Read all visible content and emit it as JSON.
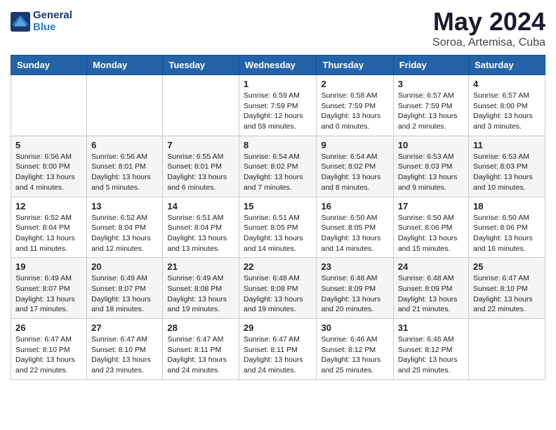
{
  "header": {
    "logo_line1": "General",
    "logo_line2": "Blue",
    "title": "May 2024",
    "subtitle": "Soroa, Artemisa, Cuba"
  },
  "weekdays": [
    "Sunday",
    "Monday",
    "Tuesday",
    "Wednesday",
    "Thursday",
    "Friday",
    "Saturday"
  ],
  "weeks": [
    [
      {
        "day": "",
        "info": ""
      },
      {
        "day": "",
        "info": ""
      },
      {
        "day": "",
        "info": ""
      },
      {
        "day": "1",
        "info": "Sunrise: 6:59 AM\nSunset: 7:59 PM\nDaylight: 12 hours\nand 59 minutes."
      },
      {
        "day": "2",
        "info": "Sunrise: 6:58 AM\nSunset: 7:59 PM\nDaylight: 13 hours\nand 0 minutes."
      },
      {
        "day": "3",
        "info": "Sunrise: 6:57 AM\nSunset: 7:59 PM\nDaylight: 13 hours\nand 2 minutes."
      },
      {
        "day": "4",
        "info": "Sunrise: 6:57 AM\nSunset: 8:00 PM\nDaylight: 13 hours\nand 3 minutes."
      }
    ],
    [
      {
        "day": "5",
        "info": "Sunrise: 6:56 AM\nSunset: 8:00 PM\nDaylight: 13 hours\nand 4 minutes."
      },
      {
        "day": "6",
        "info": "Sunrise: 6:56 AM\nSunset: 8:01 PM\nDaylight: 13 hours\nand 5 minutes."
      },
      {
        "day": "7",
        "info": "Sunrise: 6:55 AM\nSunset: 8:01 PM\nDaylight: 13 hours\nand 6 minutes."
      },
      {
        "day": "8",
        "info": "Sunrise: 6:54 AM\nSunset: 8:02 PM\nDaylight: 13 hours\nand 7 minutes."
      },
      {
        "day": "9",
        "info": "Sunrise: 6:54 AM\nSunset: 8:02 PM\nDaylight: 13 hours\nand 8 minutes."
      },
      {
        "day": "10",
        "info": "Sunrise: 6:53 AM\nSunset: 8:03 PM\nDaylight: 13 hours\nand 9 minutes."
      },
      {
        "day": "11",
        "info": "Sunrise: 6:53 AM\nSunset: 8:03 PM\nDaylight: 13 hours\nand 10 minutes."
      }
    ],
    [
      {
        "day": "12",
        "info": "Sunrise: 6:52 AM\nSunset: 8:04 PM\nDaylight: 13 hours\nand 11 minutes."
      },
      {
        "day": "13",
        "info": "Sunrise: 6:52 AM\nSunset: 8:04 PM\nDaylight: 13 hours\nand 12 minutes."
      },
      {
        "day": "14",
        "info": "Sunrise: 6:51 AM\nSunset: 8:04 PM\nDaylight: 13 hours\nand 13 minutes."
      },
      {
        "day": "15",
        "info": "Sunrise: 6:51 AM\nSunset: 8:05 PM\nDaylight: 13 hours\nand 14 minutes."
      },
      {
        "day": "16",
        "info": "Sunrise: 6:50 AM\nSunset: 8:05 PM\nDaylight: 13 hours\nand 14 minutes."
      },
      {
        "day": "17",
        "info": "Sunrise: 6:50 AM\nSunset: 8:06 PM\nDaylight: 13 hours\nand 15 minutes."
      },
      {
        "day": "18",
        "info": "Sunrise: 6:50 AM\nSunset: 8:06 PM\nDaylight: 13 hours\nand 16 minutes."
      }
    ],
    [
      {
        "day": "19",
        "info": "Sunrise: 6:49 AM\nSunset: 8:07 PM\nDaylight: 13 hours\nand 17 minutes."
      },
      {
        "day": "20",
        "info": "Sunrise: 6:49 AM\nSunset: 8:07 PM\nDaylight: 13 hours\nand 18 minutes."
      },
      {
        "day": "21",
        "info": "Sunrise: 6:49 AM\nSunset: 8:08 PM\nDaylight: 13 hours\nand 19 minutes."
      },
      {
        "day": "22",
        "info": "Sunrise: 6:48 AM\nSunset: 8:08 PM\nDaylight: 13 hours\nand 19 minutes."
      },
      {
        "day": "23",
        "info": "Sunrise: 6:48 AM\nSunset: 8:09 PM\nDaylight: 13 hours\nand 20 minutes."
      },
      {
        "day": "24",
        "info": "Sunrise: 6:48 AM\nSunset: 8:09 PM\nDaylight: 13 hours\nand 21 minutes."
      },
      {
        "day": "25",
        "info": "Sunrise: 6:47 AM\nSunset: 8:10 PM\nDaylight: 13 hours\nand 22 minutes."
      }
    ],
    [
      {
        "day": "26",
        "info": "Sunrise: 6:47 AM\nSunset: 8:10 PM\nDaylight: 13 hours\nand 22 minutes."
      },
      {
        "day": "27",
        "info": "Sunrise: 6:47 AM\nSunset: 8:10 PM\nDaylight: 13 hours\nand 23 minutes."
      },
      {
        "day": "28",
        "info": "Sunrise: 6:47 AM\nSunset: 8:11 PM\nDaylight: 13 hours\nand 24 minutes."
      },
      {
        "day": "29",
        "info": "Sunrise: 6:47 AM\nSunset: 8:11 PM\nDaylight: 13 hours\nand 24 minutes."
      },
      {
        "day": "30",
        "info": "Sunrise: 6:46 AM\nSunset: 8:12 PM\nDaylight: 13 hours\nand 25 minutes."
      },
      {
        "day": "31",
        "info": "Sunrise: 6:46 AM\nSunset: 8:12 PM\nDaylight: 13 hours\nand 25 minutes."
      },
      {
        "day": "",
        "info": ""
      }
    ]
  ]
}
